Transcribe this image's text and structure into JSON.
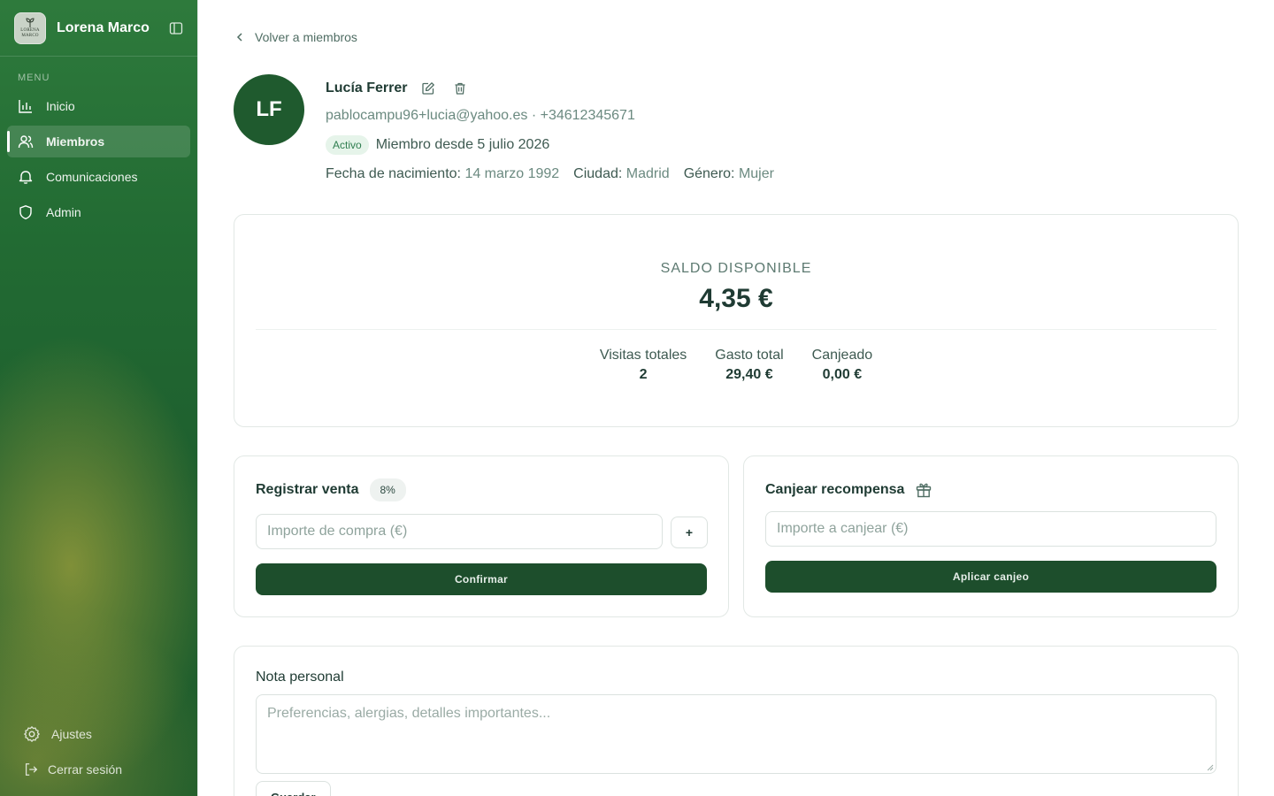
{
  "sidebar": {
    "brand_name": "Lorena Marco",
    "logo_text_1": "LORENA",
    "logo_text_2": "MARCO",
    "menu_label": "MENU",
    "items": [
      {
        "label": "Inicio",
        "icon": "chart-icon",
        "active": false
      },
      {
        "label": "Miembros",
        "icon": "users-icon",
        "active": true
      },
      {
        "label": "Comunicaciones",
        "icon": "bell-icon",
        "active": false
      },
      {
        "label": "Admin",
        "icon": "shield-icon",
        "active": false
      }
    ],
    "settings_label": "Ajustes",
    "logout_label": "Cerrar sesión"
  },
  "back_link": "Volver a miembros",
  "member": {
    "initials": "LF",
    "name": "Lucía Ferrer",
    "contact": "pablocampu96+lucia@yahoo.es · +34612345671",
    "status": "Activo",
    "since": "Miembro desde 5 julio 2026",
    "birth_label": "Fecha de nacimiento:",
    "birth_value": "14 marzo 1992",
    "city_label": "Ciudad:",
    "city_value": "Madrid",
    "gender_label": "Género:",
    "gender_value": "Mujer"
  },
  "balance": {
    "label": "SALDO DISPONIBLE",
    "value": "4,35 €",
    "stats": [
      {
        "label": "Visitas totales",
        "value": "2"
      },
      {
        "label": "Gasto total",
        "value": "29,40 €"
      },
      {
        "label": "Canjeado",
        "value": "0,00 €"
      }
    ]
  },
  "sale": {
    "title": "Registrar venta",
    "percent": "8%",
    "placeholder": "Importe de compra (€)",
    "plus": "+",
    "confirm": "Confirmar"
  },
  "redeem": {
    "title": "Canjear recompensa",
    "placeholder": "Importe a canjear (€)",
    "apply": "Aplicar canjeo"
  },
  "note": {
    "title": "Nota personal",
    "placeholder": "Preferencias, alergias, detalles importantes...",
    "save": "Guardar"
  },
  "colors": {
    "primary": "#1d4e2c",
    "sidebar": "#226b33",
    "badge_bg": "#e6f4ea"
  }
}
